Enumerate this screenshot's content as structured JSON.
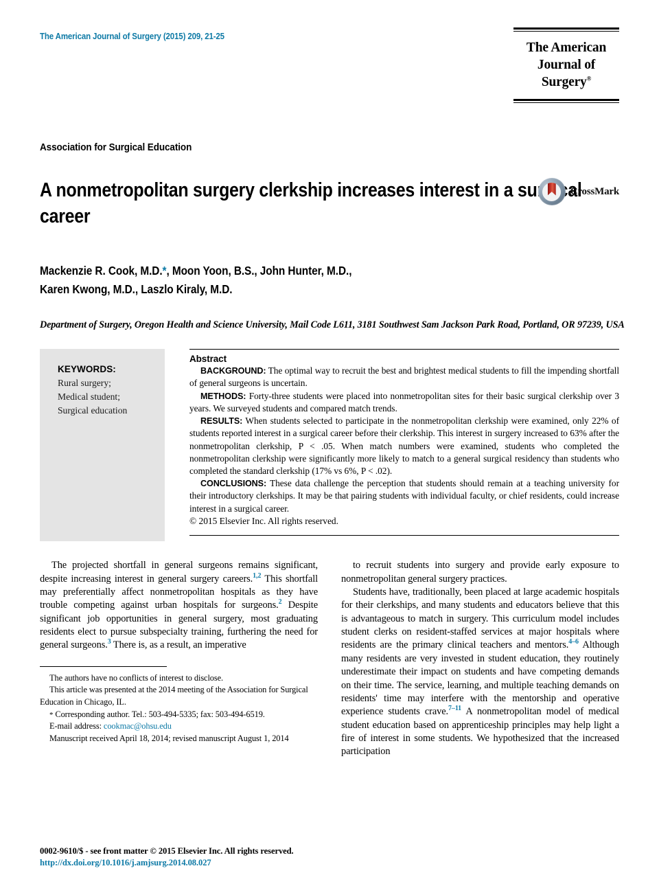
{
  "masthead": {
    "journal_reference": "The American Journal of Surgery (2015) 209, 21-25",
    "logo_line1": "The American",
    "logo_line2": "Journal of Surgery",
    "logo_trademark": "®",
    "accent_color": "#0e7aa6"
  },
  "article": {
    "society": "Association for Surgical Education",
    "title": "A nonmetropolitan surgery clerkship increases interest in a surgical career",
    "crossmark_label": "CrossMark",
    "authors_line1_a": "Mackenzie R. Cook, M.D.",
    "authors_star": "*",
    "authors_line1_b": ", Moon Yoon, B.S., John Hunter, M.D.,",
    "authors_line2": "Karen Kwong, M.D., Laszlo Kiraly, M.D.",
    "affiliation": "Department of Surgery, Oregon Health and Science University, Mail Code L611, 3181 Southwest Sam Jackson Park Road, Portland, OR 97239, USA"
  },
  "keywords": {
    "heading": "KEYWORDS:",
    "items": "Rural surgery; Medical student; Surgical education"
  },
  "abstract": {
    "heading": "Abstract",
    "background_label": "BACKGROUND:",
    "background_text": "The optimal way to recruit the best and brightest medical students to fill the impending shortfall of general surgeons is uncertain.",
    "methods_label": "METHODS:",
    "methods_text": "Forty-three students were placed into nonmetropolitan sites for their basic surgical clerkship over 3 years. We surveyed students and compared match trends.",
    "results_label": "RESULTS:",
    "results_text": "When students selected to participate in the nonmetropolitan clerkship were examined, only 22% of students reported interest in a surgical career before their clerkship. This interest in surgery increased to 63% after the nonmetropolitan clerkship, P < .05. When match numbers were examined, students who completed the nonmetropolitan clerkship were significantly more likely to match to a general surgical residency than students who completed the standard clerkship (17% vs 6%, P < .02).",
    "conclusions_label": "CONCLUSIONS:",
    "conclusions_text": "These data challenge the perception that students should remain at a teaching university for their introductory clerkships. It may be that pairing students with individual faculty, or chief residents, could increase interest in a surgical career.",
    "copyright": "© 2015 Elsevier Inc. All rights reserved."
  },
  "body": {
    "left_p1_a": "The projected shortfall in general surgeons remains significant, despite increasing interest in general surgery careers.",
    "left_p1_ref1": "1,2",
    "left_p1_b": " This shortfall may preferentially affect nonmetropolitan hospitals as they have trouble competing against urban hospitals for surgeons.",
    "left_p1_ref2": "2",
    "left_p1_c": " Despite significant job opportunities in general surgery, most graduating residents elect to pursue subspecialty training, furthering the need for general surgeons.",
    "left_p1_ref3": "3",
    "left_p1_d": " There is, as a result, an imperative",
    "right_p1": "to recruit students into surgery and provide early exposure to nonmetropolitan general surgery practices.",
    "right_p2_a": "Students have, traditionally, been placed at large academic hospitals for their clerkships, and many students and educators believe that this is advantageous to match in surgery. This curriculum model includes student clerks on resident-staffed services at major hospitals where residents are the primary clinical teachers and mentors.",
    "right_p2_ref1": "4–6",
    "right_p2_b": " Although many residents are very invested in student education, they routinely underestimate their impact on students and have competing demands on their time. The service, learning, and multiple teaching demands on residents' time may interfere with the mentorship and operative experience students crave.",
    "right_p2_ref2": "7–11",
    "right_p2_c": " A nonmetropolitan model of medical student education based on apprenticeship principles may help light a fire of interest in some students. We hypothesized that the increased participation"
  },
  "footnotes": {
    "conflicts": "The authors have no conflicts of interest to disclose.",
    "presented": "This article was presented at the 2014 meeting of the Association for Surgical Education in Chicago, IL.",
    "corresponding_star": "*",
    "corresponding": " Corresponding author. Tel.: 503-494-5335; fax: 503-494-6519.",
    "email_label": "E-mail address: ",
    "email": "cookmac@ohsu.edu",
    "manuscript": "Manuscript received April 18, 2014; revised manuscript August 1, 2014"
  },
  "page_footer": {
    "issn": "0002-9610/$ - see front matter © 2015 Elsevier Inc. All rights reserved.",
    "doi": "http://dx.doi.org/10.1016/j.amjsurg.2014.08.027"
  }
}
